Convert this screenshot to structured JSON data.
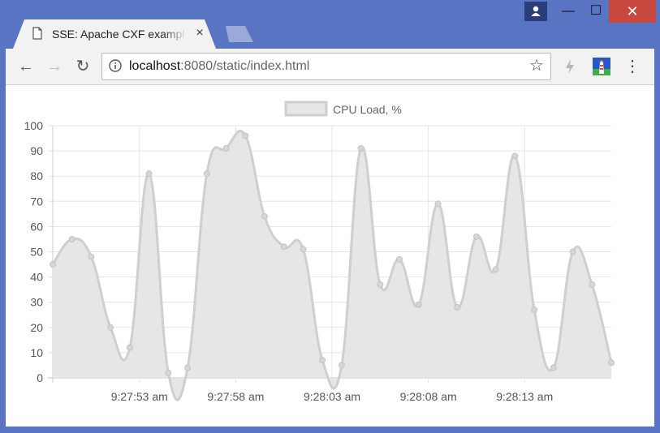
{
  "browser": {
    "tab_title": "SSE: Apache CXF example",
    "tab_close": "×",
    "url_host": "localhost",
    "url_rest": ":8080/static/index.html",
    "buttons": {
      "back": "←",
      "forward": "→",
      "reload": "↻",
      "star": "☆",
      "menu": "⋮",
      "minimize": "—",
      "maximize": "☐",
      "close": "✕"
    },
    "colors": {
      "frame": "#5a74c4",
      "close_button": "#c9483d"
    }
  },
  "chart_data": {
    "type": "area",
    "series": [
      {
        "name": "CPU Load, %",
        "values": [
          45,
          55,
          48,
          20,
          12,
          81,
          2,
          4,
          81,
          91,
          96,
          64,
          52,
          51,
          7,
          5,
          91,
          37,
          47,
          29,
          69,
          28,
          56,
          43,
          88,
          27,
          4,
          50,
          37,
          6
        ],
        "color": "#cfcfcf",
        "fill": "#e6e6e6"
      }
    ],
    "ylim": [
      0,
      100
    ],
    "yticks": [
      "0",
      "10",
      "20",
      "30",
      "40",
      "50",
      "60",
      "70",
      "80",
      "90",
      "100"
    ],
    "xticks": [
      {
        "index": 4.5,
        "label": "9:27:53 am"
      },
      {
        "index": 9.5,
        "label": "9:27:58 am"
      },
      {
        "index": 14.5,
        "label": "9:28:03 am"
      },
      {
        "index": 19.5,
        "label": "9:28:08 am"
      },
      {
        "index": 24.5,
        "label": "9:28:13 am"
      }
    ],
    "legend": "top",
    "grid": true
  }
}
